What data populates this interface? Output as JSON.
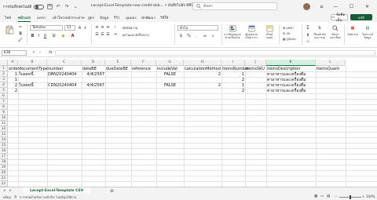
{
  "titlebar": {
    "autosave_label": "การบันทึกอัตโนมัติ",
    "doc_title": "Lecept-Excel-Template-new-credit-deb... • บันทึกไปยัง พีซีนี้ ˅",
    "search_placeholder": "ค้นหา"
  },
  "tabs": [
    "ไฟล์",
    "หน้าแรก",
    "แทรก",
    "เค้าโครงหน้ากระดาษ",
    "สูตร",
    "ข้อมูล",
    "รีวิว",
    "มุมมอง",
    "นักพัฒนา",
    "วิธีใช้"
  ],
  "active_tab": "หน้าแรก",
  "comment_label": "ข้อคิดเห็น",
  "share_label": "แชร์",
  "ribbon": {
    "font_name": "Tahoma",
    "font_size": "11",
    "number_format": "ทั่วไป",
    "wrap_label": "ตัดข้อความ",
    "merge_label": "ผสานและจัดกึ่งกลาง",
    "cond_format": "การจัดรูปแบบ\nตามเงื่อนไข",
    "format_table": "จัดรูปแบบ\nเป็นตาราง",
    "cell_styles": "สไตล์\nเซลล์",
    "insert": "แทรก",
    "delete": "ลบ",
    "format": "รูปแบบ",
    "sort_filter": "เรียงลำดับ\nและกรอง",
    "find_select": "ค้นหา\nและเลือก",
    "addins": "Add-ins",
    "analyze": "วิเคราะห์\nข้อมูล"
  },
  "formula_bar": {
    "name_box": "K36",
    "fx": "fx"
  },
  "columns": [
    "A",
    "B",
    "C",
    "D",
    "E",
    "F",
    "G",
    "H",
    "I",
    "J",
    "K",
    "L"
  ],
  "rows": [
    "1",
    "2",
    "3",
    "4",
    "5",
    "6",
    "7",
    "8",
    "9",
    "10",
    "11",
    "12",
    "13",
    "14",
    "15",
    "16",
    "17",
    "18",
    "19",
    "20",
    "21",
    "22"
  ],
  "cells": {
    "row1": [
      "order",
      "documentType",
      "number",
      "dateBE",
      "dueDateBE",
      "reference",
      "includeVat",
      "calculationMethod",
      "itemsNumber",
      "itemsSKU",
      "itemsDescription",
      "itemsQuant"
    ],
    "row2": [
      "1",
      "ใบลดหนี้",
      "DBN20240404",
      "4/4/2567",
      "",
      "",
      "FALSE",
      "2",
      "1",
      "",
      "ค่าอาหารและเครื่องดื่ม",
      ""
    ],
    "row3": [
      "1",
      "",
      "",
      "",
      "",
      "",
      "",
      "",
      "2",
      "",
      "ค่าอาหารและเครื่องดื่ม",
      ""
    ],
    "row4": [
      "2",
      "ใบลดหนี้",
      "CDN20240404",
      "4/4/2567",
      "",
      "",
      "FALSE",
      "2",
      "1",
      "",
      "ค่าอาหารและเครื่องดื่ม",
      ""
    ],
    "row5": [
      "2",
      "",
      "",
      "",
      "",
      "",
      "",
      "",
      "2",
      "",
      "ค่าอาหารและเครื่องดื่ม",
      ""
    ]
  },
  "sheet_tab": "Lecept-Excel-Template CSV",
  "status": {
    "ready": "พร้อม",
    "accessibility": "การช่วยสำหรับการเข้าถึง: ไม่พร้อมใช้งาน",
    "zoom": "100%"
  },
  "colors": {
    "accent": "#107c41",
    "brand_dark": "#185c37"
  }
}
